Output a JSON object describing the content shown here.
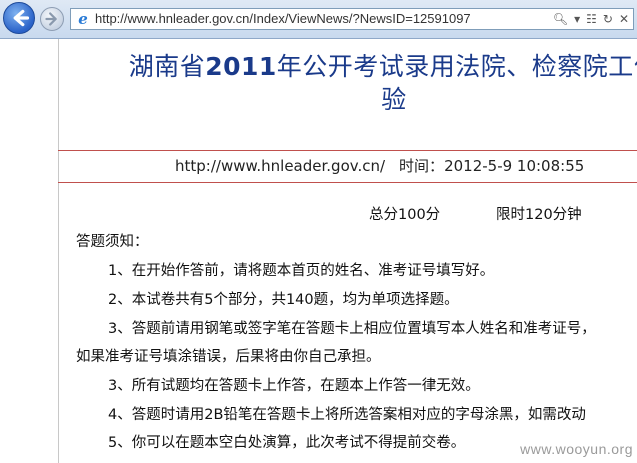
{
  "browser": {
    "url": "http://www.hnleader.gov.cn/Index/ViewNews/?NewsID=12591097",
    "address_icons": [
      "search-icon",
      "dropdown-icon",
      "compatibility-icon",
      "refresh-icon",
      "stop-icon"
    ]
  },
  "article": {
    "title_prefix": "湖南省",
    "title_year": "2011",
    "title_suffix": "年公开考试录用法院、检察院工作",
    "title_line2": "验",
    "source": "http://www.hnleader.gov.cn/",
    "time_label": "时间：",
    "time_value": "2012-5-9 10:08:55"
  },
  "exam": {
    "total_score": "总分100分",
    "time_limit": "限时120分钟",
    "notice_heading": "答题须知：",
    "items": [
      "1、在开始作答前，请将题本首页的姓名、准考证号填写好。",
      "2、本试卷共有5个部分，共140题，均为单项选择题。",
      "3、答题前请用钢笔或签字笔在答题卡上相应位置填写本人姓名和准考证号，",
      "如果准考证号填涂错误，后果将由你自己承担。",
      "3、所有试题均在答题卡上作答，在题本上作答一律无效。",
      "4、答题时请用2B铅笔在答题卡上将所选答案相对应的字母涂黑，如需改动",
      "5、你可以在题本空白处演算，此次考试不得提前交卷。"
    ]
  },
  "watermark": "www.wooyun.org"
}
